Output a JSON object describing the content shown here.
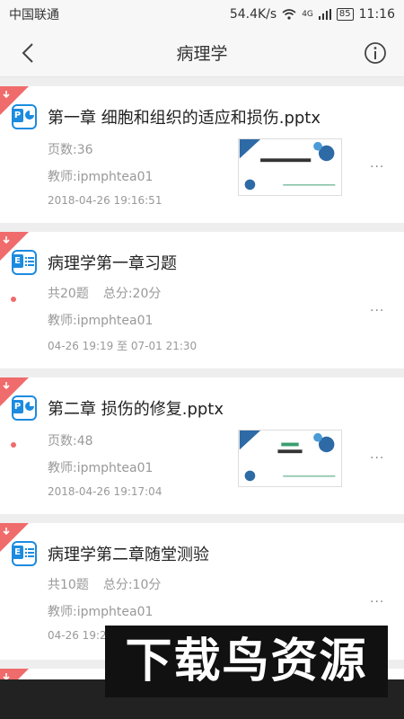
{
  "status_bar": {
    "carrier": "中国联通",
    "network_speed": "54.4K/s",
    "network_type": "4G",
    "battery": "85",
    "time": "11:16"
  },
  "header": {
    "title": "病理学",
    "back_icon": "chevron-left-icon",
    "info_icon": "info-icon"
  },
  "items": [
    {
      "type": "pptx",
      "title": "第一章 细胞和组织的适应和损伤.pptx",
      "meta": "页数:36",
      "teacher": "教师:ipmphtea01",
      "date": "2018-04-26 19:16:51",
      "unread": false
    },
    {
      "type": "exercise",
      "title": "病理学第一章习题",
      "count": "共20题",
      "score": "总分:20分",
      "teacher": "教师:ipmphtea01",
      "date": "04-26 19:19  至  07-01 21:30",
      "unread": true
    },
    {
      "type": "pptx",
      "title": "第二章 损伤的修复.pptx",
      "meta": "页数:48",
      "teacher": "教师:ipmphtea01",
      "date": "2018-04-26 19:17:04",
      "unread": true
    },
    {
      "type": "exercise",
      "title": "病理学第二章随堂测验",
      "count": "共10题",
      "score": "总分:10分",
      "teacher": "教师:ipmphtea01",
      "date": "04-26 19:20",
      "unread": false
    }
  ],
  "more_label": "···",
  "watermark": "下载鸟资源",
  "colors": {
    "accent": "#1c8be0",
    "corner": "#f06b6b",
    "unread_dot": "#f06b6b"
  }
}
